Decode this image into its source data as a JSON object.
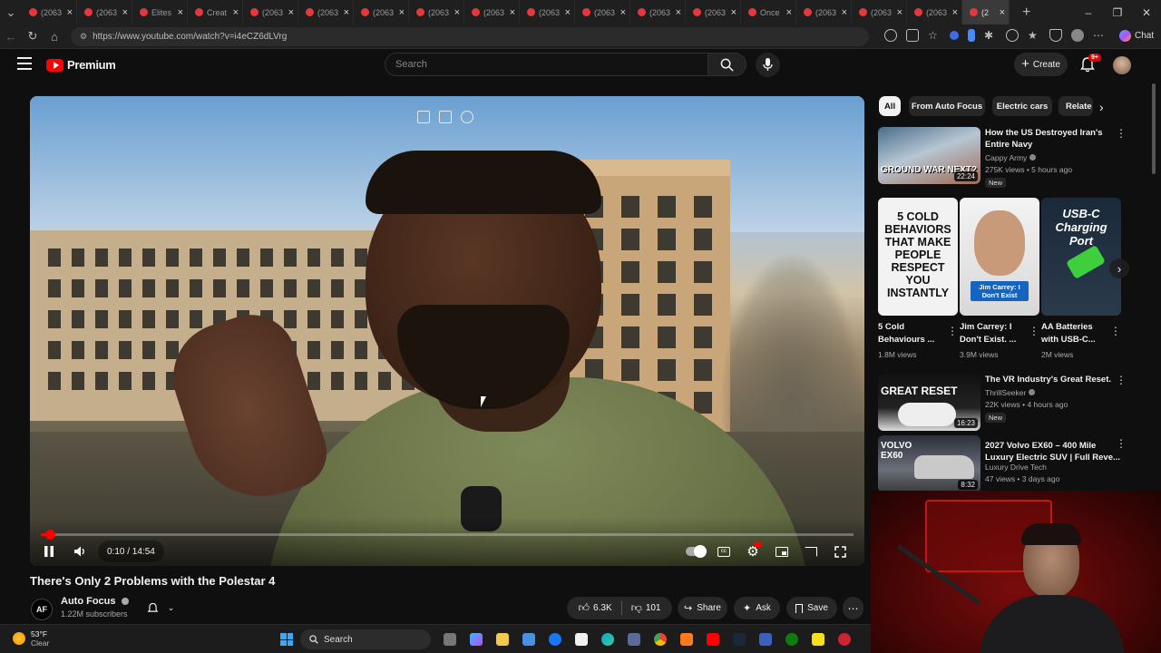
{
  "browser": {
    "tabs": [
      {
        "label": "(2063"
      },
      {
        "label": "(2063"
      },
      {
        "label": "Elites"
      },
      {
        "label": "Creat"
      },
      {
        "label": "(2063"
      },
      {
        "label": "(2063"
      },
      {
        "label": "(2063"
      },
      {
        "label": "(2063"
      },
      {
        "label": "(2063"
      },
      {
        "label": "(2063"
      },
      {
        "label": "(2063"
      },
      {
        "label": "(2063"
      },
      {
        "label": "(2063"
      },
      {
        "label": "Once"
      },
      {
        "label": "(2063"
      },
      {
        "label": "(2063"
      },
      {
        "label": "(2063"
      },
      {
        "label": "(2"
      }
    ],
    "url": "https://www.youtube.com/watch?v=i4eCZ6dLVrg",
    "chat_label": "Chat"
  },
  "youtube": {
    "logo_text": "Premium",
    "search_placeholder": "Search",
    "create_label": "Create",
    "notification_badge": "9+"
  },
  "video": {
    "current_time": "0:10",
    "duration": "14:54",
    "time_display": "0:10 / 14:54",
    "progress_fraction": 0.011,
    "title": "There's Only 2 Problems with the Polestar 4",
    "channel": {
      "name": "Auto Focus",
      "avatar_text": "AF",
      "subscribers": "1.22M subscribers"
    },
    "actions": {
      "likes": "6.3K",
      "dislikes": "101",
      "share": "Share",
      "ask": "Ask",
      "save": "Save"
    }
  },
  "sidebar": {
    "chips": [
      "All",
      "From Auto Focus",
      "Electric cars",
      "Relate"
    ],
    "videos": [
      {
        "title": "How the US Destroyed Iran's Entire Navy",
        "channel": "Cappy Army",
        "meta": "275K views • 5 hours ago",
        "badge": "New",
        "duration": "22:24",
        "thumb_text": "GROUND WAR NEXT?"
      },
      {
        "title": "The VR Industry's Great Reset.",
        "channel": "ThrillSeeker",
        "meta": "22K views • 4 hours ago",
        "badge": "New",
        "duration": "16:23",
        "thumb_text": "GREAT RESET"
      },
      {
        "title": "2027 Volvo EX60 – 400 Mile Luxury Electric SUV | Full Reve...",
        "channel": "Luxury Drive Tech",
        "meta": "47 views • 3 days ago",
        "badge": "",
        "duration": "8:32",
        "thumb_text": "VOLVO EX60"
      }
    ],
    "shorts": [
      {
        "title": "5 Cold Behaviours ...",
        "views": "1.8M views",
        "thumb_text": "5 COLD BEHAVIORS THAT MAKE PEOPLE RESPECT YOU INSTANTLY"
      },
      {
        "title": "Jim Carrey: I Don't Exist. ...",
        "views": "3.9M views",
        "thumb_text": "Jim Carrey: I Don't Exist"
      },
      {
        "title": "AA Batteries with USB-C...",
        "views": "2M views",
        "thumb_text": "USB-C Charging Port"
      }
    ]
  },
  "taskbar": {
    "weather_temp": "53°F",
    "weather_desc": "Clear",
    "search_label": "Search"
  }
}
